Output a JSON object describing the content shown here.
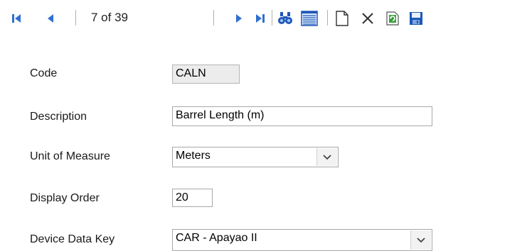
{
  "toolbar": {
    "record_position": "7 of 39",
    "buttons": [
      {
        "name": "first-record",
        "icon": "first-record-icon"
      },
      {
        "name": "previous-record",
        "icon": "previous-record-icon"
      },
      {
        "name": "next-record",
        "icon": "next-record-icon"
      },
      {
        "name": "last-record",
        "icon": "last-record-icon"
      },
      {
        "name": "find",
        "icon": "binoculars-icon"
      },
      {
        "name": "list-view",
        "icon": "list-view-icon"
      },
      {
        "name": "new-record",
        "icon": "new-document-icon"
      },
      {
        "name": "delete-record",
        "icon": "close-icon"
      },
      {
        "name": "refresh",
        "icon": "refresh-icon"
      },
      {
        "name": "save",
        "icon": "save-icon"
      }
    ],
    "colors": {
      "nav": "#2f6fd0",
      "toolbar_icons": "#1e57b8"
    }
  },
  "form": {
    "code": {
      "label": "Code",
      "value": "CALN"
    },
    "description": {
      "label": "Description",
      "value": "Barrel Length (m)"
    },
    "unit_of_measure": {
      "label": "Unit of Measure",
      "value": "Meters"
    },
    "display_order": {
      "label": "Display Order",
      "value": "20"
    },
    "device_data_key": {
      "label": "Device Data Key",
      "value": "CAR - Apayao II"
    }
  }
}
